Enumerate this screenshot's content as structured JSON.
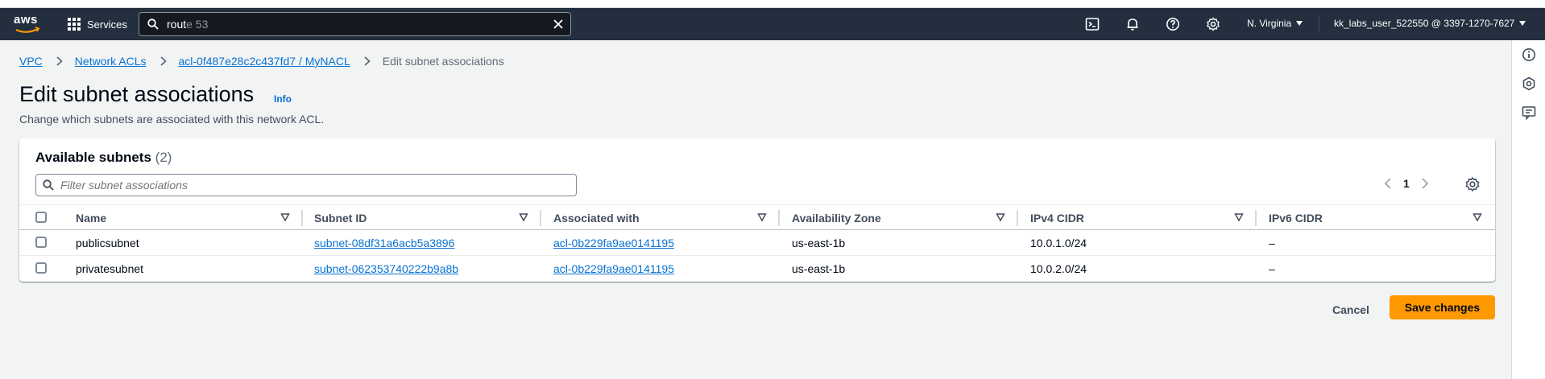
{
  "topnav": {
    "logo_text": "aws",
    "services_label": "Services",
    "search": {
      "typed": "rout",
      "suggestion": "e 53"
    },
    "region": "N. Virginia",
    "account": "kk_labs_user_522550 @ 3397-1270-7627"
  },
  "breadcrumb": {
    "items": [
      "VPC",
      "Network ACLs",
      "acl-0f487e28c2c437fd7 / MyNACL"
    ],
    "current": "Edit subnet associations"
  },
  "page": {
    "title": "Edit subnet associations",
    "info_label": "Info",
    "description": "Change which subnets are associated with this network ACL."
  },
  "table": {
    "title": "Available subnets",
    "count": "(2)",
    "filter_placeholder": "Filter subnet associations",
    "page_number": "1",
    "columns": [
      "Name",
      "Subnet ID",
      "Associated with",
      "Availability Zone",
      "IPv4 CIDR",
      "IPv6 CIDR"
    ],
    "rows": [
      {
        "name": "publicsubnet",
        "subnet_id": "subnet-08df31a6acb5a3896",
        "associated_with": "acl-0b229fa9ae0141195",
        "az": "us-east-1b",
        "ipv4": "10.0.1.0/24",
        "ipv6": "–"
      },
      {
        "name": "privatesubnet",
        "subnet_id": "subnet-062353740222b9a8b",
        "associated_with": "acl-0b229fa9ae0141195",
        "az": "us-east-1b",
        "ipv4": "10.0.2.0/24",
        "ipv6": "–"
      }
    ]
  },
  "actions": {
    "cancel": "Cancel",
    "save": "Save changes"
  },
  "colors": {
    "nav_bg": "#232f3e",
    "link": "#0972d3",
    "primary": "#ff9900",
    "page_bg": "#f2f3f3"
  },
  "icons": [
    "grid-icon",
    "search-icon",
    "clear-icon",
    "cloudshell-icon",
    "bell-icon",
    "help-icon",
    "settings-icon",
    "info-circle-icon",
    "hexagon-icon",
    "feedback-icon",
    "chevron-right-icon",
    "sort-icon",
    "chevron-left-icon"
  ]
}
